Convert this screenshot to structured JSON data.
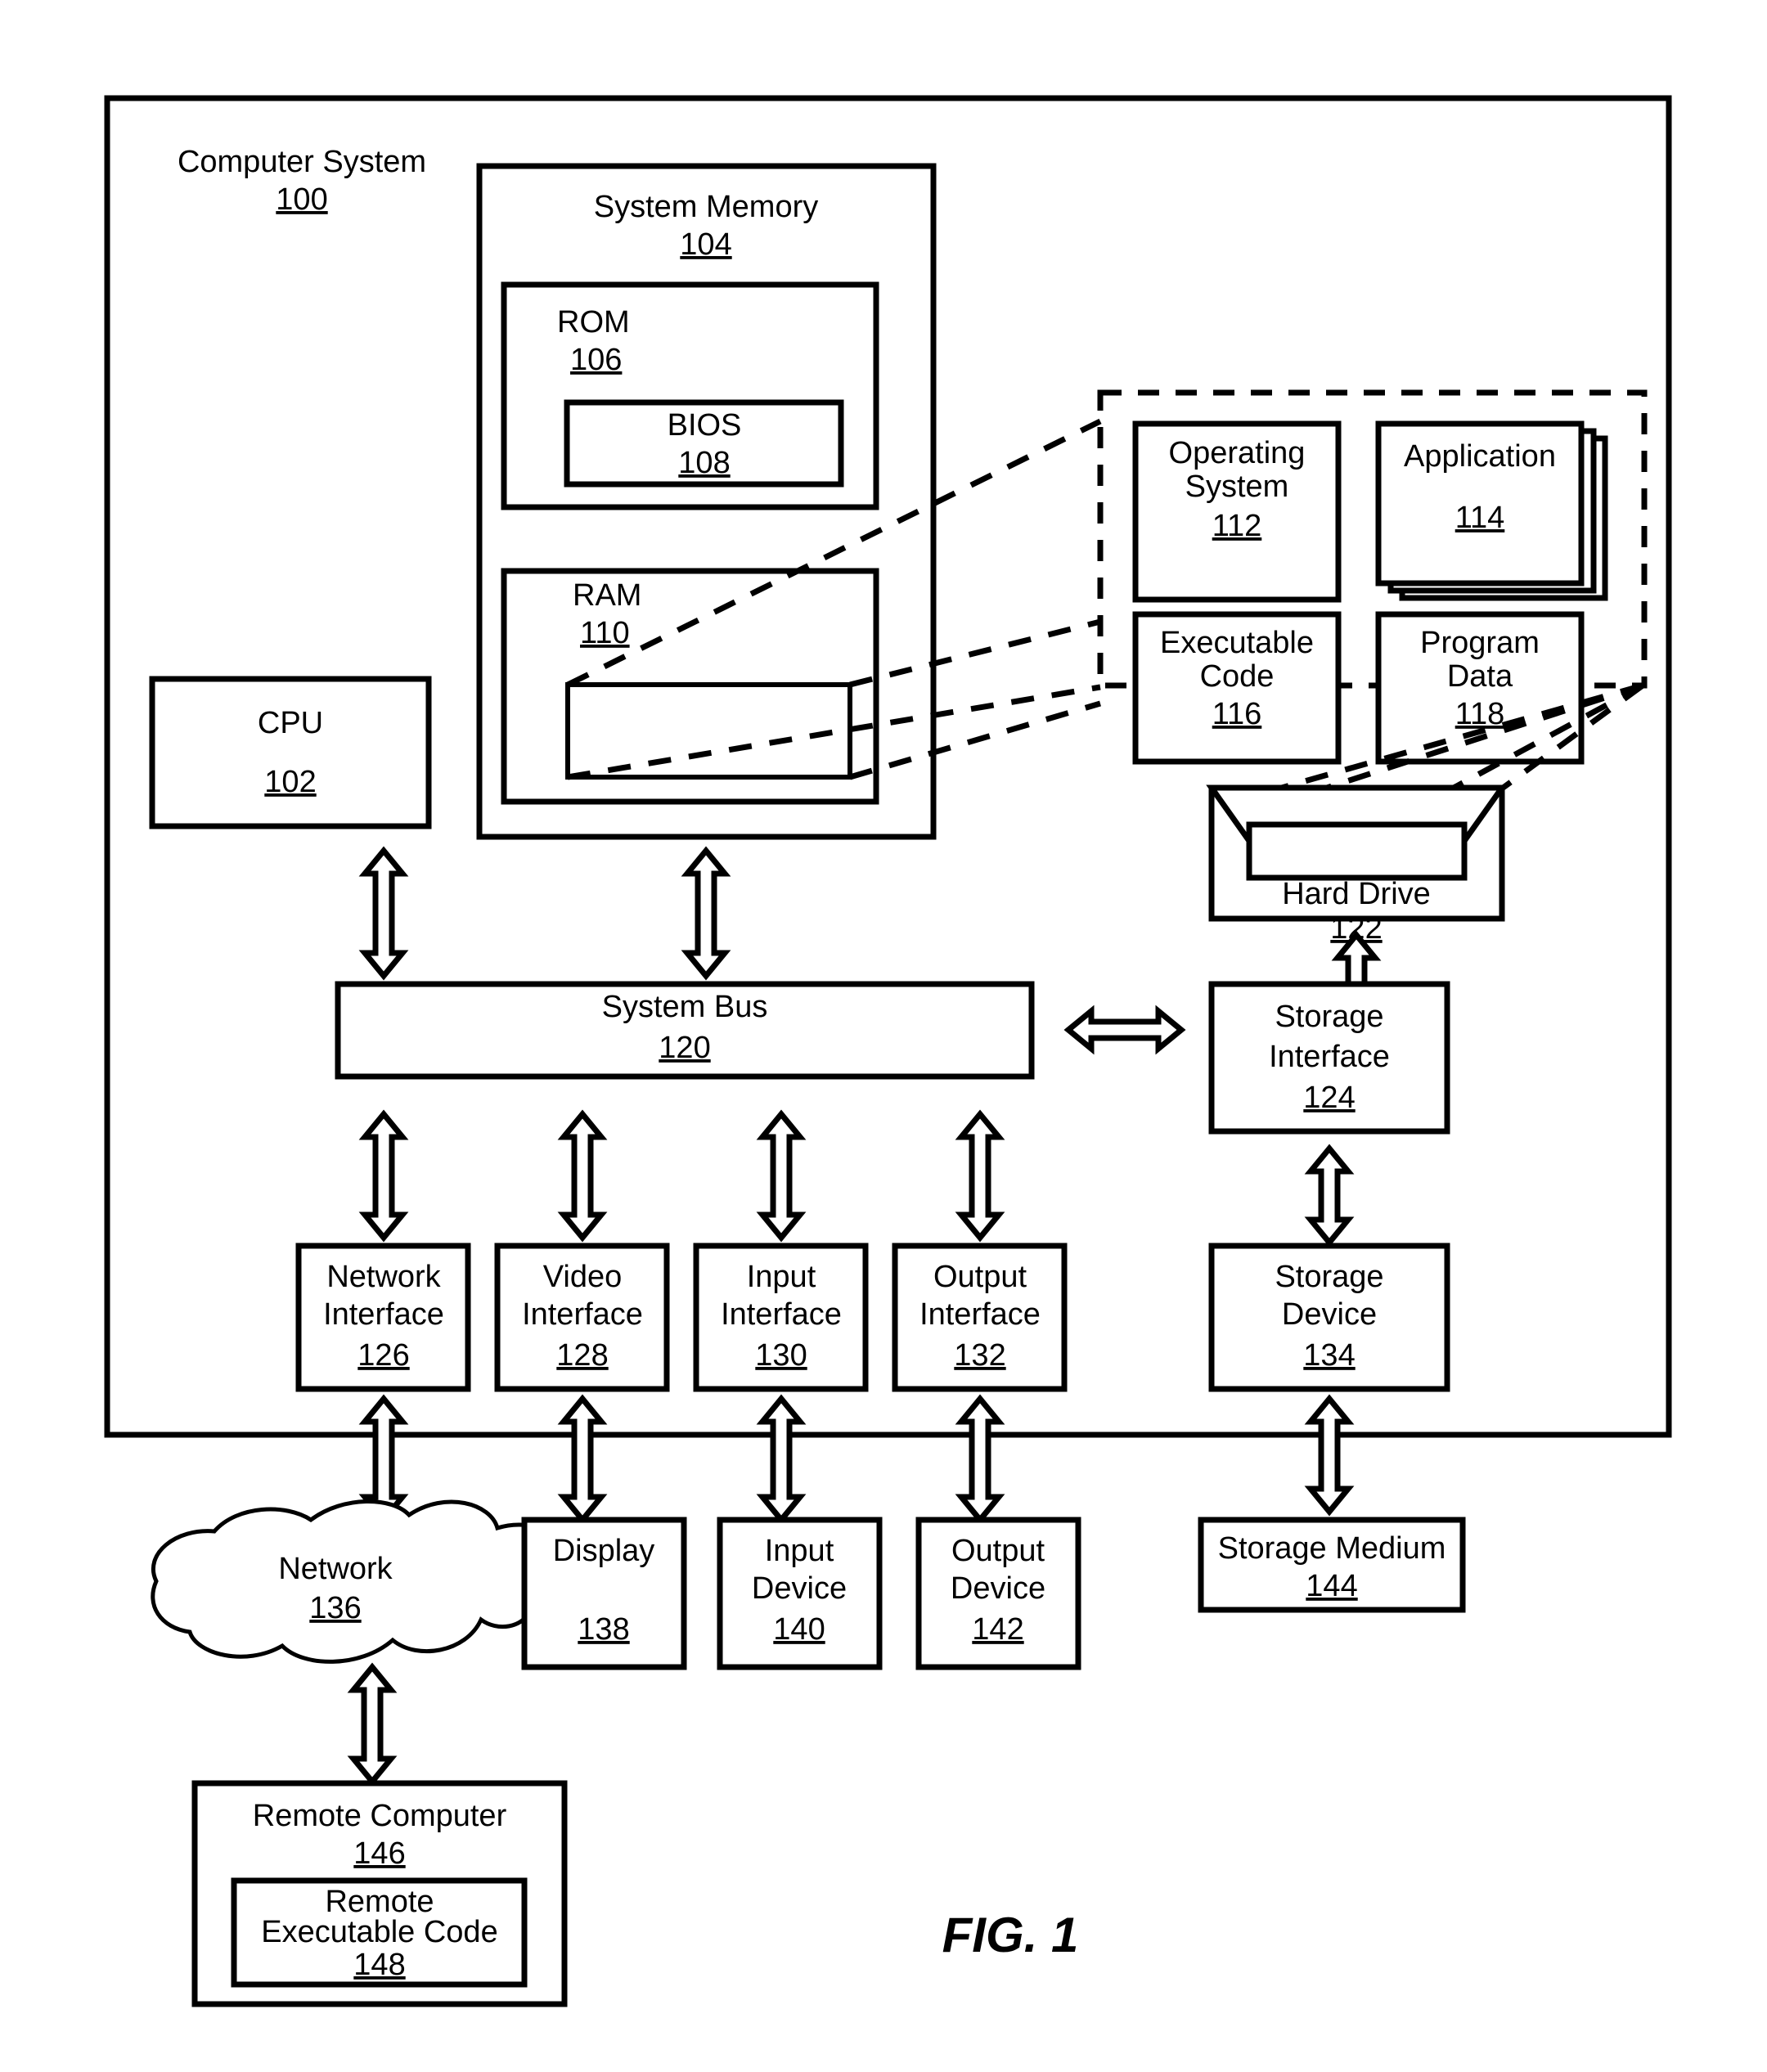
{
  "figure": {
    "caption": "FIG. 1",
    "stroke_color": "#000000",
    "background_color": "#ffffff"
  },
  "outer_container": {
    "label": "Computer System",
    "ref": "100"
  },
  "system_memory": {
    "label": "System Memory",
    "ref": "104",
    "rom": {
      "label": "ROM",
      "ref": "106",
      "bios": {
        "label": "BIOS",
        "ref": "108"
      }
    },
    "ram": {
      "label": "RAM",
      "ref": "110",
      "inner_block_label": ""
    }
  },
  "memory_contents_callout": {
    "items": [
      {
        "line1": "Operating",
        "line2": "System",
        "ref": "112",
        "stacked": false
      },
      {
        "line1": "Application",
        "line2": "",
        "ref": "114",
        "stacked": true
      },
      {
        "line1": "Executable",
        "line2": "Code",
        "ref": "116",
        "stacked": false
      },
      {
        "line1": "Program",
        "line2": "Data",
        "ref": "118",
        "stacked": false
      }
    ]
  },
  "cpu": {
    "label": "CPU",
    "ref": "102"
  },
  "system_bus": {
    "label": "System Bus",
    "ref": "120"
  },
  "hard_drive": {
    "label": "Hard Drive",
    "ref": "122"
  },
  "storage_interface": {
    "line1": "Storage",
    "line2": "Interface",
    "ref": "124"
  },
  "storage_device": {
    "line1": "Storage",
    "line2": "Device",
    "ref": "134"
  },
  "storage_medium": {
    "label": "Storage Medium",
    "ref": "144"
  },
  "interfaces": [
    {
      "line1": "Network",
      "line2": "Interface",
      "ref": "126"
    },
    {
      "line1": "Video",
      "line2": "Interface",
      "ref": "128"
    },
    {
      "line1": "Input",
      "line2": "Interface",
      "ref": "130"
    },
    {
      "line1": "Output",
      "line2": "Interface",
      "ref": "132"
    }
  ],
  "devices": [
    {
      "line1": "Display",
      "line2": "",
      "ref": "138"
    },
    {
      "line1": "Input",
      "line2": "Device",
      "ref": "140"
    },
    {
      "line1": "Output",
      "line2": "Device",
      "ref": "142"
    }
  ],
  "network": {
    "label": "Network",
    "ref": "136"
  },
  "remote_computer": {
    "label": "Remote Computer",
    "ref": "146",
    "remote_executable_code": {
      "line1": "Remote",
      "line2": "Executable Code",
      "ref": "148"
    }
  }
}
